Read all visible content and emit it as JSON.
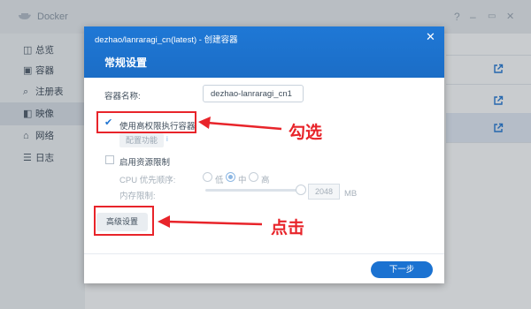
{
  "app": {
    "title": "Docker"
  },
  "titlebar": {
    "help": "?",
    "minimize": "–",
    "maximize": "▭",
    "close": "✕"
  },
  "sidebar": {
    "items": [
      {
        "label": "总览",
        "icon": "overview-icon",
        "glyph": "◫"
      },
      {
        "label": "容器",
        "icon": "container-icon",
        "glyph": "▣"
      },
      {
        "label": "注册表",
        "icon": "registry-icon",
        "glyph": "⌕"
      },
      {
        "label": "映像",
        "icon": "image-icon",
        "glyph": "◧",
        "active": true
      },
      {
        "label": "网络",
        "icon": "network-icon",
        "glyph": "⌂"
      },
      {
        "label": "日志",
        "icon": "log-icon",
        "glyph": "☰"
      }
    ]
  },
  "dialog": {
    "title": "dezhao/lanraragi_cn(latest) - 创建容器",
    "close_glyph": "✕",
    "section_title": "常规设置",
    "container_name_label": "容器名称:",
    "container_name_value": "dezhao-lanraragi_cn1",
    "privilege_checkbox_label": "使用高权限执行容器",
    "privilege_checked": true,
    "config_button": "配置功能",
    "info_glyph": "i",
    "resource_limit_label": "启用资源限制",
    "resource_limit_checked": false,
    "cpu_priority_label": "CPU 优先顺序:",
    "cpu_options": [
      "低",
      "中",
      "高"
    ],
    "cpu_selected": "中",
    "memory_limit_label": "内存限制:",
    "memory_value": "2048",
    "memory_unit": "MB",
    "advanced_button": "高级设置",
    "next_button": "下一步"
  },
  "annotations": {
    "check_note": "勾选",
    "click_note": "点击",
    "color": "#e8242a"
  },
  "colors": {
    "accent": "#1b72d1",
    "annotation": "#e8242a"
  }
}
